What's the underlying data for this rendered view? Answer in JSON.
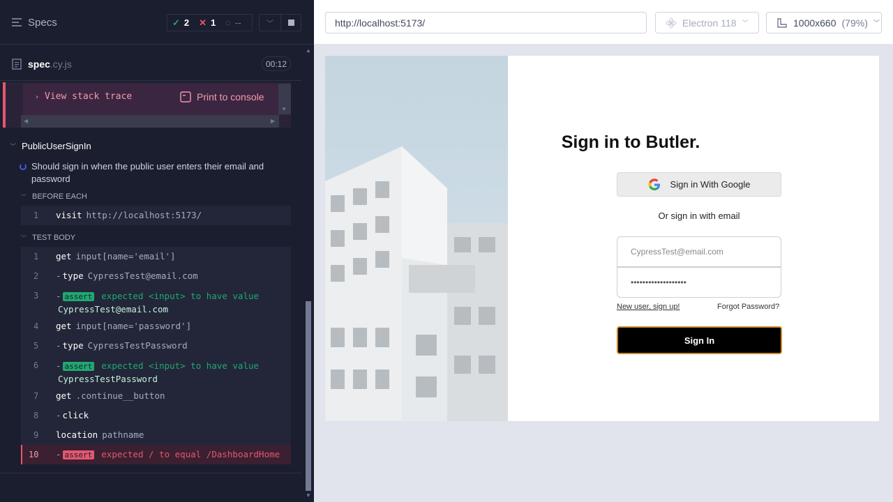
{
  "header": {
    "specs_label": "Specs",
    "passed": "2",
    "failed": "1",
    "pending": "--"
  },
  "spec": {
    "name": "spec",
    "ext": ".cy.js",
    "duration": "00:12"
  },
  "error": {
    "stack_trace_label": "View stack trace",
    "print_label": "Print to console"
  },
  "suite": {
    "name": "PublicUserSignIn",
    "test_title": "Should sign in when the public user enters their email and password",
    "before_each_label": "BEFORE EACH",
    "test_body_label": "TEST BODY",
    "before_each": [
      {
        "num": "1",
        "name": "visit",
        "arg": "http://localhost:5173/"
      }
    ],
    "commands": [
      {
        "num": "1",
        "name": "get",
        "arg": "input[name='email']"
      },
      {
        "num": "2",
        "name": "type",
        "arg": "CypressTest@email.com"
      },
      {
        "num": "3",
        "badge": "assert",
        "msg": "expected <input> to have value",
        "val": "CypressTest@email.com"
      },
      {
        "num": "4",
        "name": "get",
        "arg": "input[name='password']"
      },
      {
        "num": "5",
        "name": "type",
        "arg": "CypressTestPassword"
      },
      {
        "num": "6",
        "badge": "assert",
        "msg": "expected <input> to have value",
        "val": "CypressTestPassword"
      },
      {
        "num": "7",
        "name": "get",
        "arg": ".continue__button"
      },
      {
        "num": "8",
        "name": "click",
        "arg": ""
      },
      {
        "num": "9",
        "name": "location",
        "arg": "pathname"
      },
      {
        "num": "10",
        "badge": "assert",
        "msg": "expected / to equal /DashboardHome"
      }
    ]
  },
  "browser": {
    "url": "http://localhost:5173/",
    "browser_name": "Electron 118",
    "viewport": "1000x660",
    "zoom": "(79%)"
  },
  "app": {
    "title": "Sign in to Butler.",
    "google_label": "Sign in With Google",
    "or_label": "Or sign in with email",
    "email_value": "CypressTest@email.com",
    "password_value": "•••••••••••••••••••",
    "signup_link": "New user, sign up!",
    "forgot_link": "Forgot Password?",
    "signin_button": "Sign In"
  },
  "colors": {
    "pass": "#1fa971",
    "fail": "#e45770",
    "panel_bg": "#1b1e2e",
    "accent_border": "#c9882a"
  }
}
